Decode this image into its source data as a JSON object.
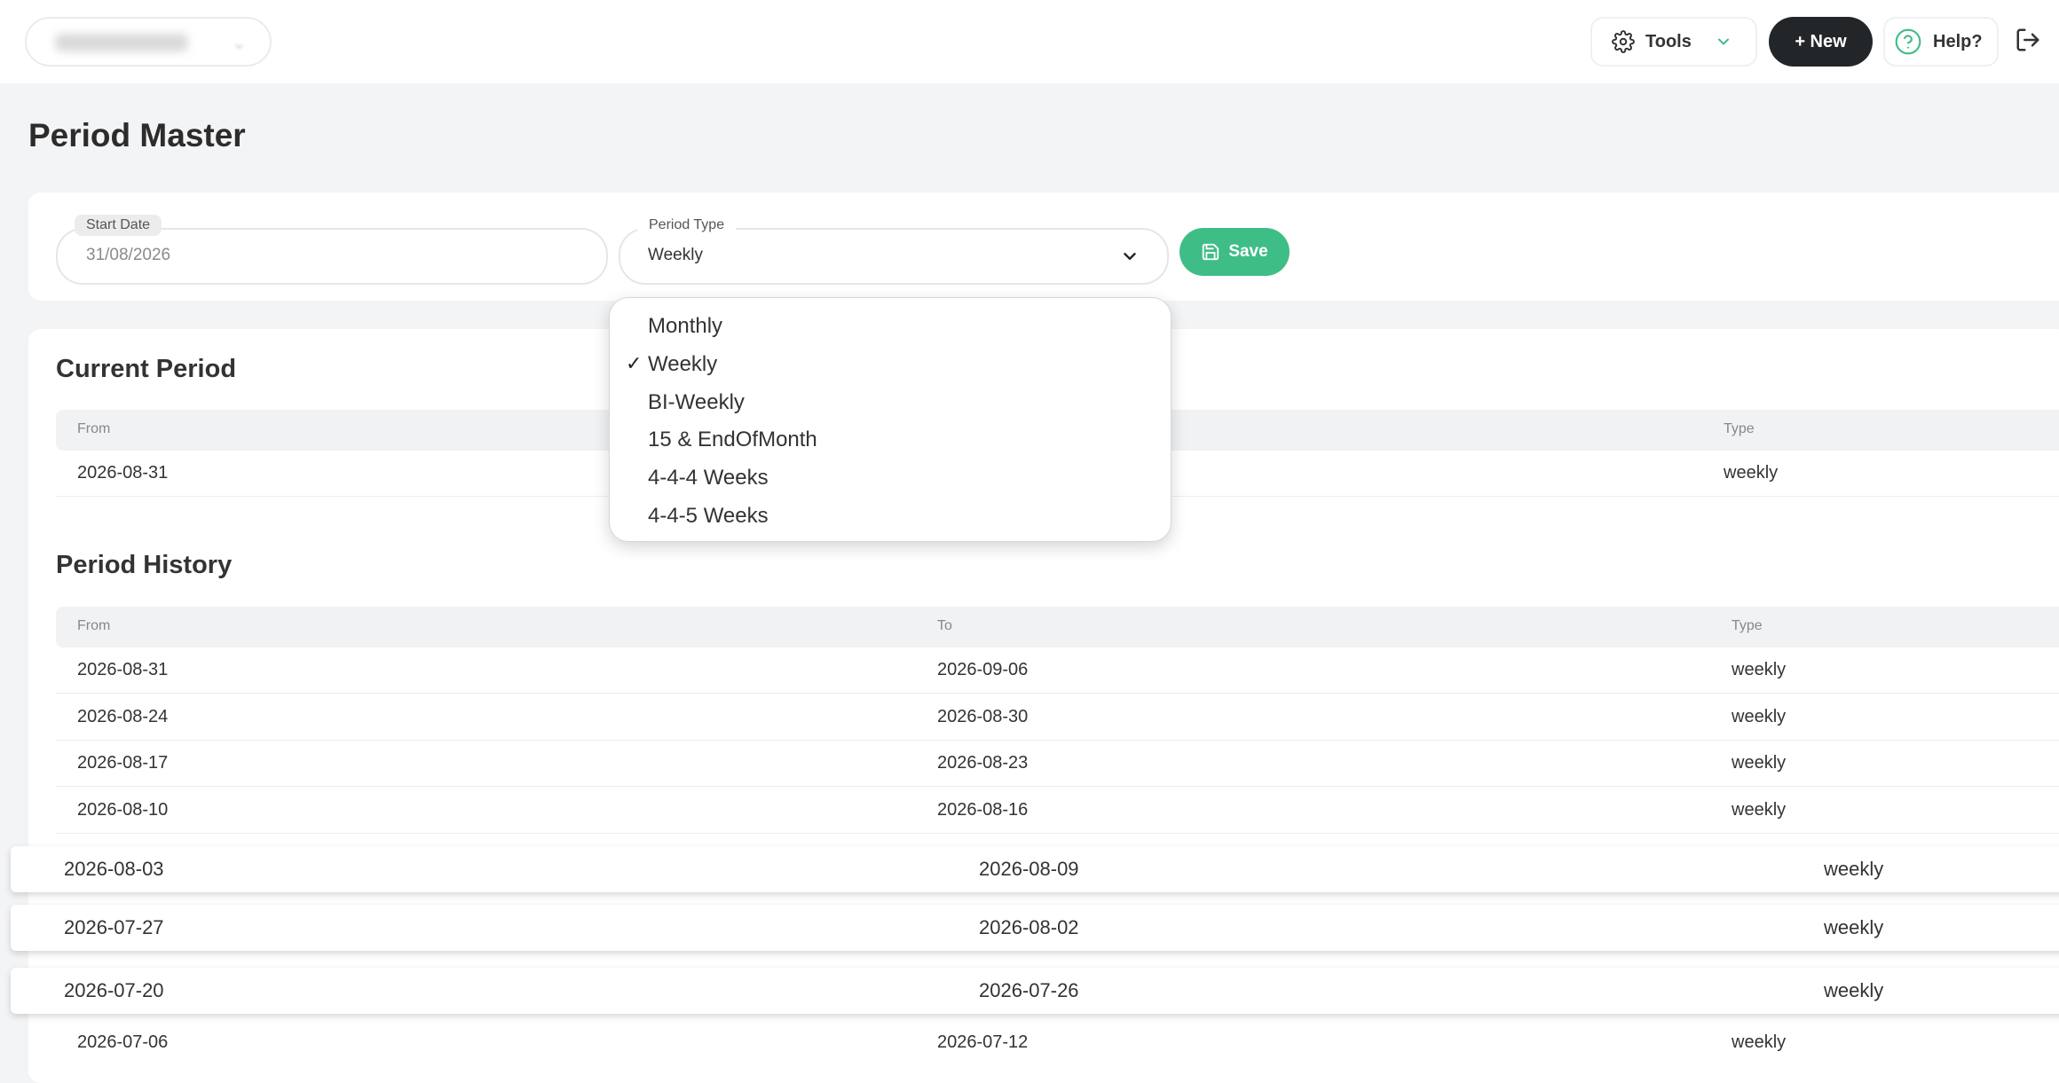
{
  "header": {
    "tools_label": "Tools",
    "new_label": "+ New",
    "help_label": "Help?"
  },
  "page": {
    "title": "Period Master"
  },
  "form": {
    "start_date_label": "Start Date",
    "start_date_value": "31/08/2026",
    "period_type_label": "Period Type",
    "period_type_value": "Weekly",
    "save_label": "Save"
  },
  "dropdown": {
    "options": [
      "Monthly",
      "Weekly",
      "BI-Weekly",
      "15 & EndOfMonth",
      "4-4-4 Weeks",
      "4-4-5 Weeks"
    ],
    "selected_mark": "✓"
  },
  "current_period": {
    "title": "Current Period",
    "headers": {
      "from": "From",
      "type": "Type"
    },
    "row": {
      "from": "2026-08-31",
      "type": "weekly"
    }
  },
  "period_history": {
    "title": "Period History",
    "headers": {
      "from": "From",
      "to": "To",
      "type": "Type"
    },
    "rows": [
      {
        "from": "2026-08-31",
        "to": "2026-09-06",
        "type": "weekly"
      },
      {
        "from": "2026-08-24",
        "to": "2026-08-30",
        "type": "weekly"
      },
      {
        "from": "2026-08-17",
        "to": "2026-08-23",
        "type": "weekly"
      },
      {
        "from": "2026-08-10",
        "to": "2026-08-16",
        "type": "weekly"
      },
      {
        "from": "2026-08-03",
        "to": "2026-08-09",
        "type": "weekly"
      },
      {
        "from": "2026-07-27",
        "to": "2026-08-02",
        "type": "weekly"
      },
      {
        "from": "2026-07-20",
        "to": "2026-07-26",
        "type": "weekly"
      },
      {
        "from": "2026-07-06",
        "to": "2026-07-12",
        "type": "weekly"
      }
    ]
  },
  "colors": {
    "accent": "#3fbd87",
    "dark_button": "#232629",
    "background": "#f3f4f6"
  }
}
